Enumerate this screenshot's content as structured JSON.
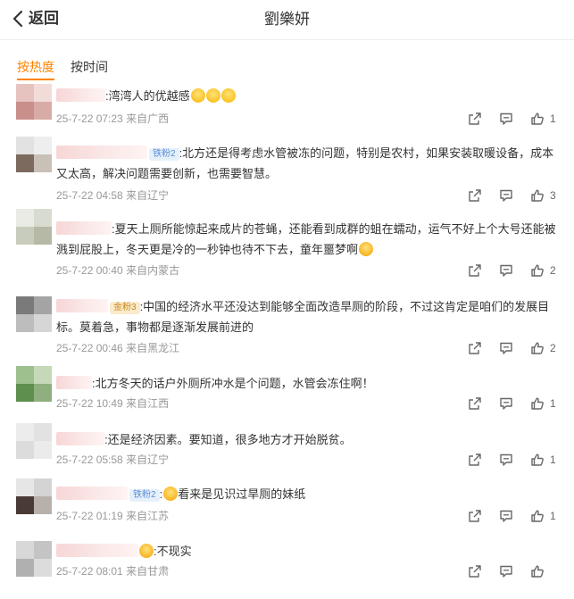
{
  "header": {
    "back_label": "返回",
    "title": "劉樂妍"
  },
  "tabs": [
    {
      "label": "按热度",
      "active": true
    },
    {
      "label": "按时间",
      "active": false
    }
  ],
  "colors": {
    "accent": "#ff8200",
    "meta": "#999999",
    "divider": "#eeeeee"
  },
  "comments": [
    {
      "badge": "",
      "text": ":湾湾人的优越感",
      "emojis": [
        "smile",
        "smile",
        "smile"
      ],
      "time": "25-7-22 07:23",
      "location": "来自广西",
      "likes": "1"
    },
    {
      "badge": "铁粉2",
      "text": ":北方还是得考虑水管被冻的问题，特别是农村，如果安装取暖设备，成本又太高，解决问题需要创新，也需要智慧。",
      "emojis": [],
      "time": "25-7-22 04:58",
      "location": "来自辽宁",
      "likes": "3"
    },
    {
      "badge": "",
      "text": ":夏天上厕所能惊起来成片的苍蝇，还能看到成群的蛆在蠕动，运气不好上个大号还能被溅到屁股上，冬天更是冷的一秒钟也待不下去，童年噩梦啊",
      "emojis": [
        "cry"
      ],
      "time": "25-7-22 00:40",
      "location": "来自内蒙古",
      "likes": "2"
    },
    {
      "badge": "金粉3",
      "text": ":中国的经济水平还没达到能够全面改造旱厕的阶段，不过这肯定是咱们的发展目标。莫着急，事物都是逐渐发展前进的",
      "emojis": [],
      "time": "25-7-22 00:46",
      "location": "来自黑龙江",
      "likes": "2"
    },
    {
      "badge": "",
      "text": ":北方冬天的话户外厕所冲水是个问题，水管会冻住啊！",
      "emojis": [],
      "time": "25-7-22 10:49",
      "location": "来自江西",
      "likes": "1"
    },
    {
      "badge": "",
      "text": ":还是经济因素。要知道，很多地方才开始脱贫。",
      "emojis": [],
      "time": "25-7-22 05:58",
      "location": "来自辽宁",
      "likes": "1"
    },
    {
      "badge": "铁粉2",
      "text": "看来是见识过旱厕的妹纸",
      "emojis": [],
      "lead": [
        ":",
        "cry"
      ],
      "time": "25-7-22 01:19",
      "location": "来自江苏",
      "likes": "1"
    },
    {
      "badge": "",
      "text": ":不现实",
      "emojis": [],
      "lead_emoji": "cry",
      "time": "25-7-22 08:01",
      "location": "来自甘肃",
      "likes": ""
    }
  ],
  "icons": {
    "back": "chevron-left-icon",
    "share": "share-icon",
    "comment": "comment-icon",
    "like": "thumbs-up-icon"
  }
}
